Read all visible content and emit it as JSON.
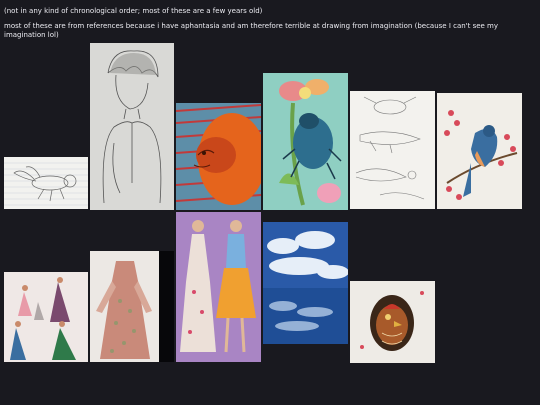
{
  "notes": {
    "line1": "(not in any kind of chronological order; most of these are a few years old)",
    "line2": "most of these are from references because i have aphantasia and am therefore terrible at drawing from imagination (because I can't see my imagination lol)"
  },
  "gallery": {
    "items": [
      {
        "name": "fly-sketch"
      },
      {
        "name": "boy-portrait-sketch"
      },
      {
        "name": "lion-painting"
      },
      {
        "name": "beetle-on-flower-painting"
      },
      {
        "name": "insect-study-sketches"
      },
      {
        "name": "bird-on-branch-painting"
      },
      {
        "name": "dancers-sketch"
      },
      {
        "name": "floral-dress-drawing"
      },
      {
        "name": "fashion-figures-drawing"
      },
      {
        "name": "cloud-seascape-painting"
      },
      {
        "name": "chicken-drawing"
      }
    ]
  },
  "colors": {
    "background": "#19191f",
    "text": "#ececf2"
  }
}
